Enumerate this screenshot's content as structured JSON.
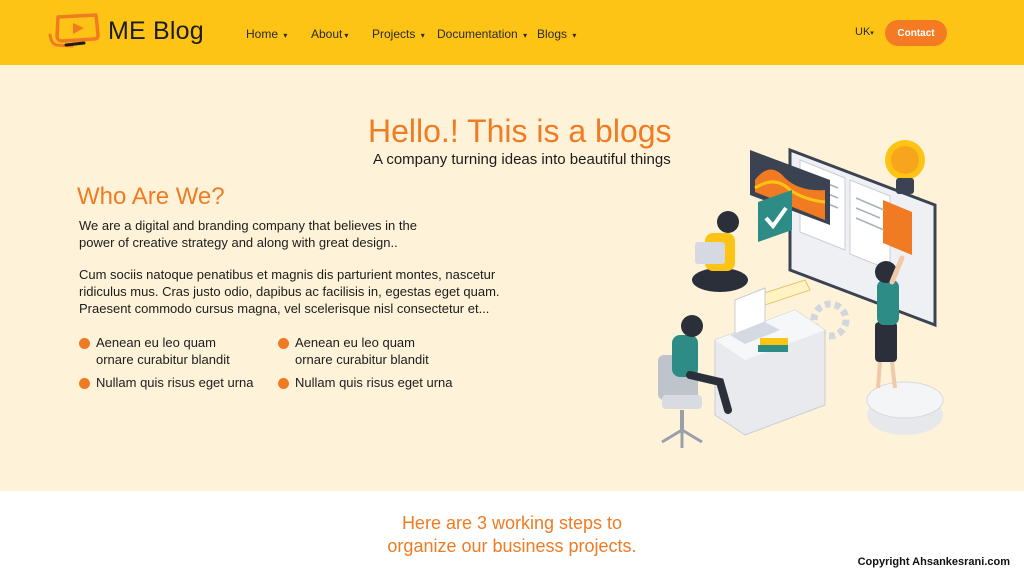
{
  "header": {
    "brand": "ME Blog",
    "nav": [
      {
        "label": "Home",
        "caret": "▾"
      },
      {
        "label": "About",
        "caret": "▾"
      },
      {
        "label": "Projects",
        "caret": "▾"
      },
      {
        "label": "Documentation",
        "caret": "▾"
      },
      {
        "label": "Blogs",
        "caret": "▾"
      }
    ],
    "language": {
      "label": "UK",
      "caret": "▾"
    },
    "contact_label": "Contact"
  },
  "hero": {
    "title": "Hello.! This is a blogs",
    "subtitle": "A company turning ideas into beautiful things",
    "section_title": "Who Are We?",
    "paragraph1": "We are a digital and branding company that believes in the power of creative strategy and along with great design..",
    "paragraph2": "Cum sociis natoque penatibus et magnis dis parturient montes, nascetur ridiculus mus. Cras justo odio, dapibus ac facilisis in, egestas eget quam. Praesent commodo cursus magna, vel scelerisque nisl consectetur et...",
    "bullets": [
      {
        "line1": "Aenean eu leo quam",
        "line2": "ornare curabitur blandit"
      },
      {
        "line1": "Aenean eu leo quam",
        "line2": "ornare curabitur blandit"
      },
      {
        "line1": "Nullam quis risus eget urna",
        "line2": ""
      },
      {
        "line1": "Nullam quis risus eget urna",
        "line2": ""
      }
    ]
  },
  "steps": {
    "line1": "Here are 3 working steps to",
    "line2": "organize our business projects."
  },
  "copyright": "Copyright Ahsankesrani.com",
  "colors": {
    "header_bg": "#fec415",
    "hero_bg": "#fef3d9",
    "accent": "#f07b22",
    "button": "#f47b23"
  },
  "icons": {
    "logo": "play-screen-logo-icon",
    "caret": "caret-down-icon",
    "bullet": "orange-dot-icon",
    "illustration": "office-team-isometric-illustration"
  }
}
